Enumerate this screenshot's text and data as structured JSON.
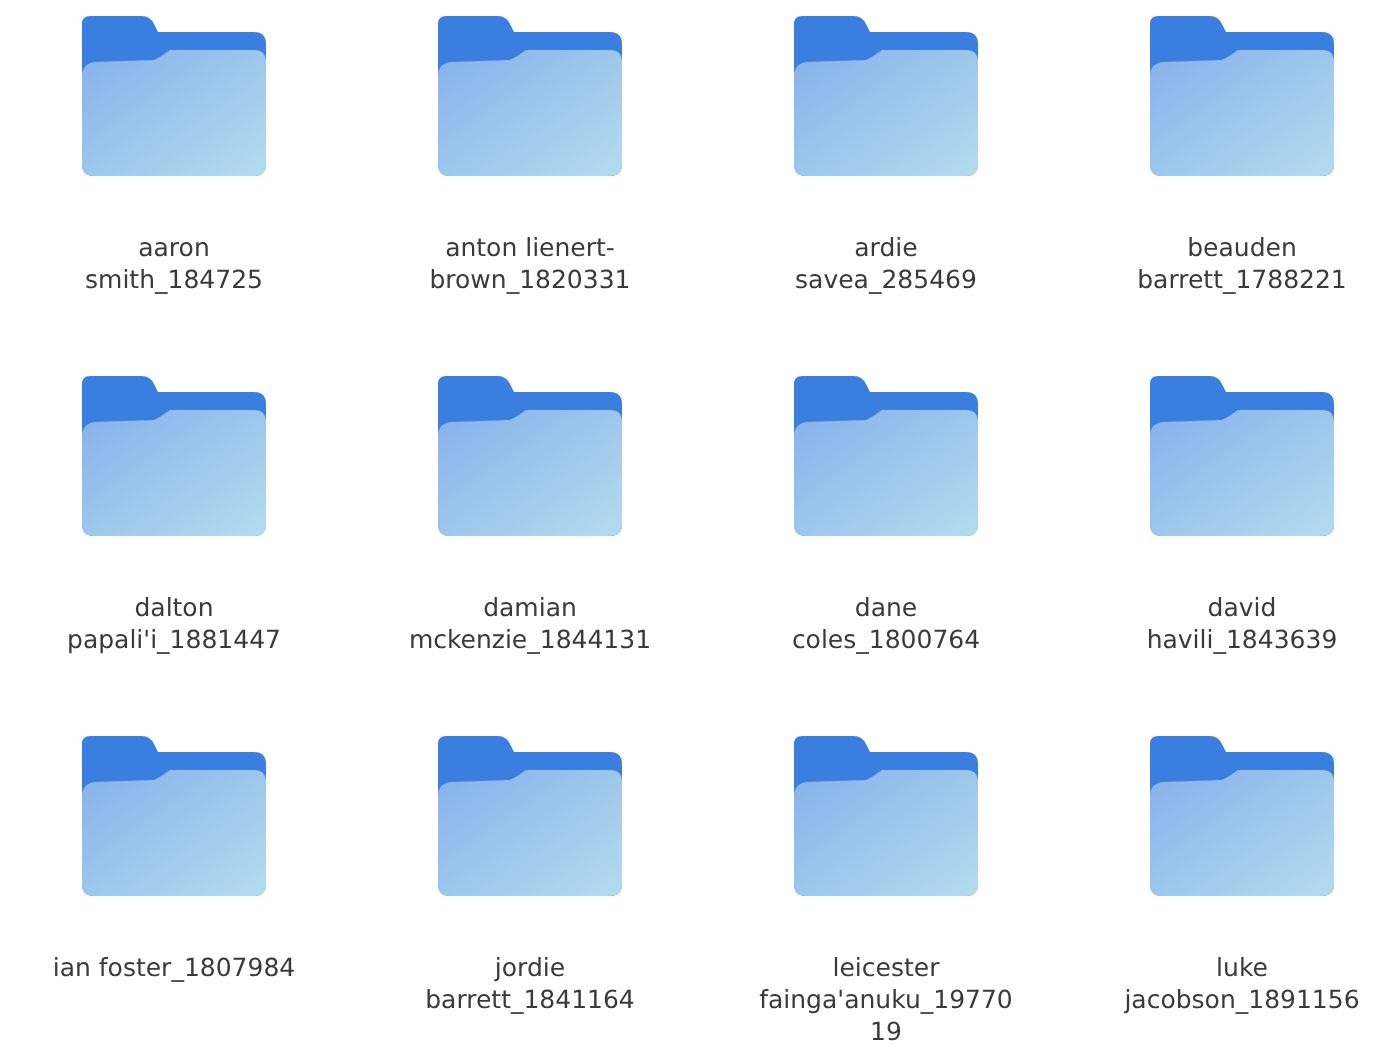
{
  "folders": [
    {
      "lines": [
        "aaron",
        "smith_184725"
      ]
    },
    {
      "lines": [
        "anton lienert-",
        "brown_1820331"
      ]
    },
    {
      "lines": [
        "ardie",
        "savea_285469"
      ]
    },
    {
      "lines": [
        "beauden",
        "barrett_1788221"
      ]
    },
    {
      "lines": [
        "dalton",
        "papali'i_1881447"
      ]
    },
    {
      "lines": [
        "damian",
        "mckenzie_1844131"
      ]
    },
    {
      "lines": [
        "dane",
        "coles_1800764"
      ]
    },
    {
      "lines": [
        "david",
        "havili_1843639"
      ]
    },
    {
      "lines": [
        "ian foster_1807984"
      ]
    },
    {
      "lines": [
        "jordie",
        "barrett_1841164"
      ]
    },
    {
      "lines": [
        "leicester",
        "fainga'anuku_19770",
        "19"
      ]
    },
    {
      "lines": [
        "luke",
        "jacobson_1891156"
      ]
    }
  ]
}
